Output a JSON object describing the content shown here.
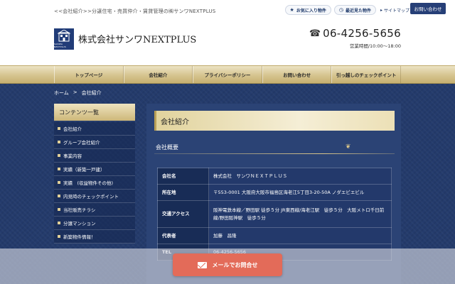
{
  "header": {
    "tagline": "<<会社紹介>>分譲住宅・売買仲介・賃貸管理の㈱サンワNEXTPLUS",
    "favorites_label": "お気に入り物件",
    "recent_label": "最近見た物件",
    "sitemap_label": "サイトマップ",
    "contact_button": "お問い合わせ",
    "company_name": "株式会社サンワNEXTPLUS",
    "logo_text": "SANWA NEXTPLUS",
    "phone": "06-4256-5656",
    "hours": "営業時間/10:00〜18:00"
  },
  "nav": {
    "items": [
      {
        "label": "トップページ"
      },
      {
        "label": "会社紹介"
      },
      {
        "label": "プライバシーポリシー"
      },
      {
        "label": "お問い合わせ"
      },
      {
        "label": "引っ越しのチェックポイント"
      }
    ]
  },
  "breadcrumb": {
    "home": "ホーム",
    "separator": ">",
    "current": "会社紹介"
  },
  "sidebar": {
    "heading": "コンテンツ一覧",
    "items": [
      {
        "label": "会社紹介"
      },
      {
        "label": "グループ会社紹介"
      },
      {
        "label": "事業内容"
      },
      {
        "label": "実績（新築一戸建）"
      },
      {
        "label": "実績　(収益物件その他)"
      },
      {
        "label": "内見時のチェックポイント"
      },
      {
        "label": "当社販売チラシ"
      },
      {
        "label": "分譲マンション"
      },
      {
        "label": "新築物件情報！"
      }
    ]
  },
  "content": {
    "title": "会社紹介",
    "subheading": "会社概要",
    "table": [
      {
        "label": "会社名",
        "value": "株式会社　サンワＮＥＸＴＰＬＵＳ"
      },
      {
        "label": "所在地",
        "value": "〒553-0001 大阪府大阪市福島区海老江5丁目3-20-50A ノダエビエビル"
      },
      {
        "label": "交通アクセス",
        "value": "阪神電鉄本線／野田駅 徒歩５分 JR東西線/海老江駅　徒歩５分　大阪メトロ千日前線/野田阪神駅　徒歩５分"
      },
      {
        "label": "代表者",
        "value": "加藤　昌隆"
      },
      {
        "label": "TEL",
        "value": "06-4256-5656"
      }
    ]
  },
  "mail_bar": {
    "button_label": "メールでお問合せ"
  },
  "colors": {
    "navy": "#243b6c",
    "gold": "#d6c48f",
    "button_red": "#e36b59",
    "contact_blue": "#263f77"
  },
  "icons": {
    "star": "star-icon",
    "clock": "clock-icon",
    "phone": "phone-icon",
    "mail": "mail-icon"
  }
}
